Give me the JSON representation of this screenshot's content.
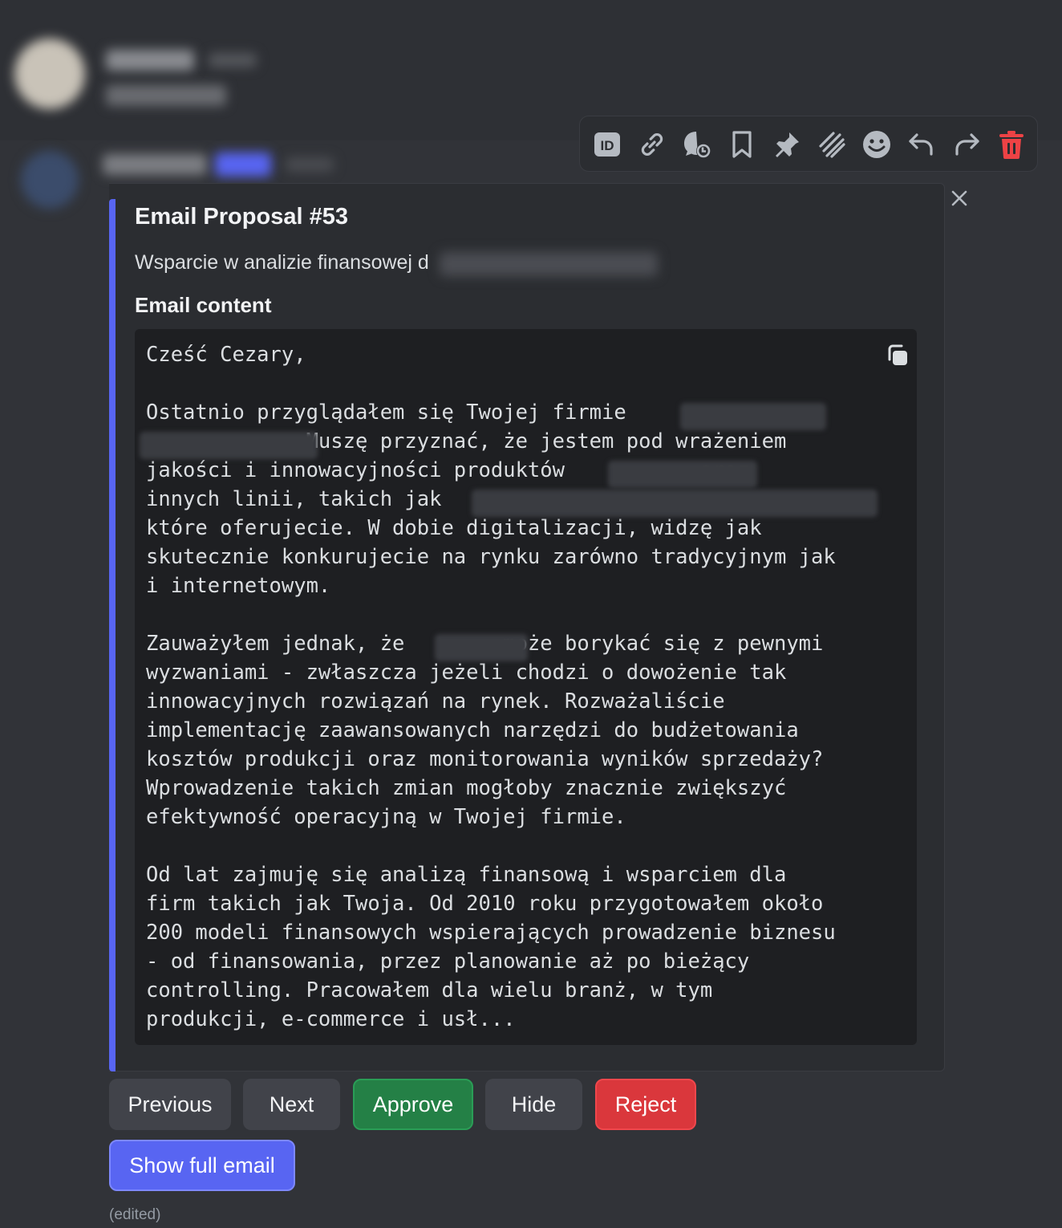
{
  "toolbar": {
    "icons": [
      "id-icon",
      "link-icon",
      "thread-icon",
      "bookmark-icon",
      "pin-icon",
      "pins-stack-icon",
      "emoji-icon",
      "reply-icon",
      "forward-icon",
      "trash-icon"
    ],
    "danger_color": "#ed4245"
  },
  "embed": {
    "accent_color": "#5865f2",
    "title": "Email Proposal #53",
    "description": "Wsparcie w analizie finansowej d",
    "field_name": "Email content",
    "content_lines": [
      "Cześć Cezary,",
      "",
      "Ostatnio przyglądałem się Twojej firmie",
      "             Muszę przyznać, że jestem pod wrażeniem",
      "jakości i innowacyjności produktów           oraz",
      "innych linii, takich jak",
      "które oferujecie. W dobie digitalizacji, widzę jak",
      "skutecznie konkurujecie na rynku zarówno tradycyjnym jak",
      "i internetowym.",
      "",
      "Zauważyłem jednak, że        może borykać się z pewnymi",
      "wyzwaniami - zwłaszcza jeżeli chodzi o dowożenie tak",
      "innowacyjnych rozwiązań na rynek. Rozważaliście",
      "implementację zaawansowanych narzędzi do budżetowania",
      "kosztów produkcji oraz monitorowania wyników sprzedaży?",
      "Wprowadzenie takich zmian mogłoby znacznie zwiększyć",
      "efektywność operacyjną w Twojej firmie.",
      "",
      "Od lat zajmuję się analizą finansową i wsparciem dla",
      "firm takich jak Twoja. Od 2010 roku przygotowałem około",
      "200 modeli finansowych wspierających prowadzenie biznesu",
      "- od finansowania, przez planowanie aż po bieżący",
      "controlling. Pracowałem dla wielu branż, w tym",
      "produkcji, e-commerce i usł..."
    ]
  },
  "buttons": {
    "previous": "Previous",
    "next": "Next",
    "approve": "Approve",
    "hide": "Hide",
    "reject": "Reject",
    "show_full": "Show full email"
  },
  "colors": {
    "approve": "#248046",
    "reject": "#da373c",
    "show_full": "#5865f2"
  },
  "edited_label": "(edited)"
}
